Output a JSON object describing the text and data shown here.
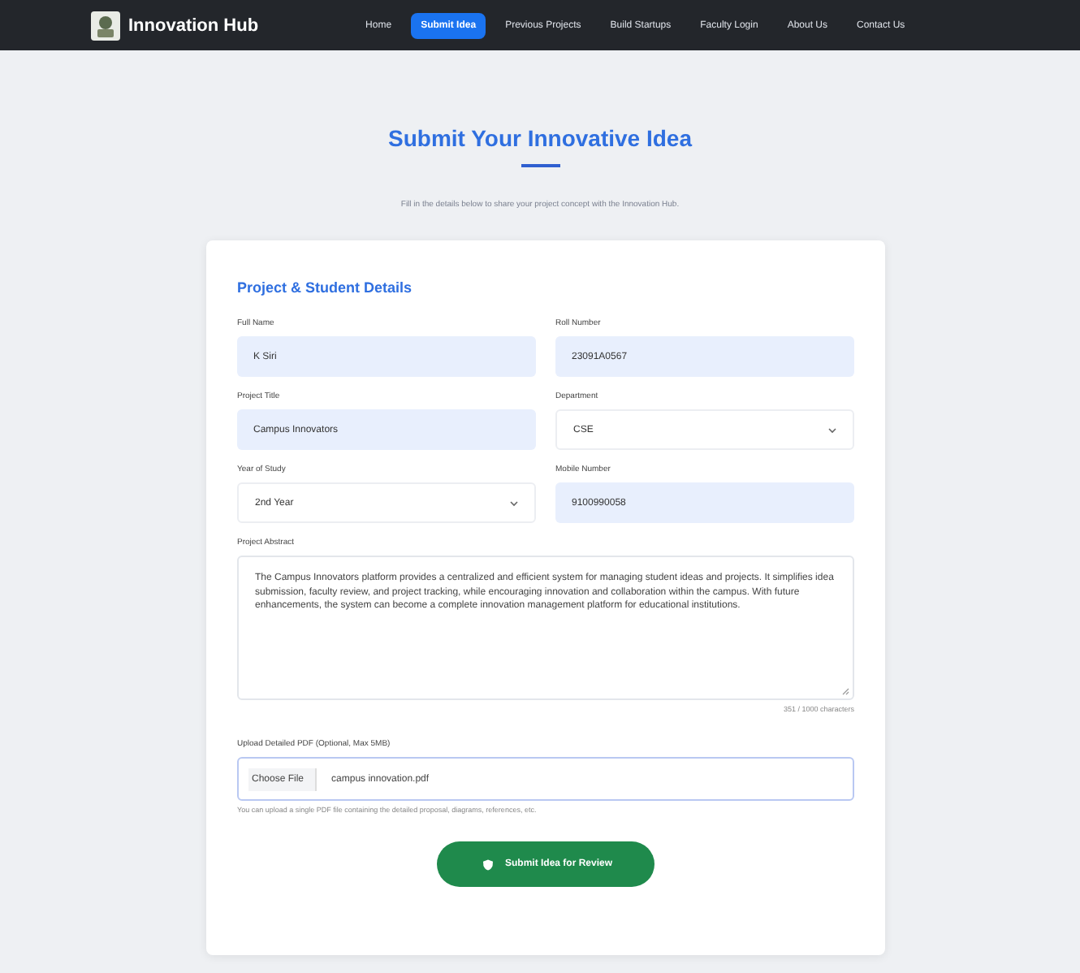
{
  "navbar": {
    "brand": "Innovation Hub",
    "links": [
      {
        "label": "Home",
        "selected": false
      },
      {
        "label": "Submit Idea",
        "selected": true
      },
      {
        "label": "Previous Projects",
        "selected": false
      },
      {
        "label": "Build Startups",
        "selected": false
      },
      {
        "label": "Faculty Login",
        "selected": false
      },
      {
        "label": "About Us",
        "selected": false
      },
      {
        "label": "Contact Us",
        "selected": false
      }
    ]
  },
  "header": {
    "title": "Submit Your Innovative Idea",
    "subtitle": "Fill in the details below to share your project concept with the Innovation Hub."
  },
  "form": {
    "section_title": "Project & Student Details",
    "fields": [
      {
        "kind": "input",
        "label": "Full Name",
        "value": "K Siri"
      },
      {
        "kind": "input",
        "label": "Roll Number",
        "value": "23091A0567"
      },
      {
        "kind": "input",
        "label": "Project Title",
        "value": "Campus Innovators"
      },
      {
        "kind": "select",
        "label": "Department",
        "value": "CSE"
      },
      {
        "kind": "select",
        "label": "Year of Study",
        "value": "2nd Year"
      },
      {
        "kind": "input",
        "label": "Mobile Number",
        "value": "9100990058"
      }
    ],
    "abstract": {
      "label": "Project Abstract",
      "value": "The Campus Innovators platform provides a centralized and efficient system for managing student ideas and projects. It simplifies idea submission, faculty review, and project tracking, while encouraging innovation and collaboration within the campus. With future enhancements, the system can become a complete innovation management platform for educational institutions.",
      "counter": "351 / 1000 characters"
    },
    "upload": {
      "label": "Upload Detailed PDF (Optional, Max 5MB)",
      "button": "Choose File",
      "file_name": "campus innovation.pdf",
      "hint": "You can upload a single PDF file containing the detailed proposal, diagrams, references, etc."
    },
    "submit": "Submit Idea for Review"
  }
}
